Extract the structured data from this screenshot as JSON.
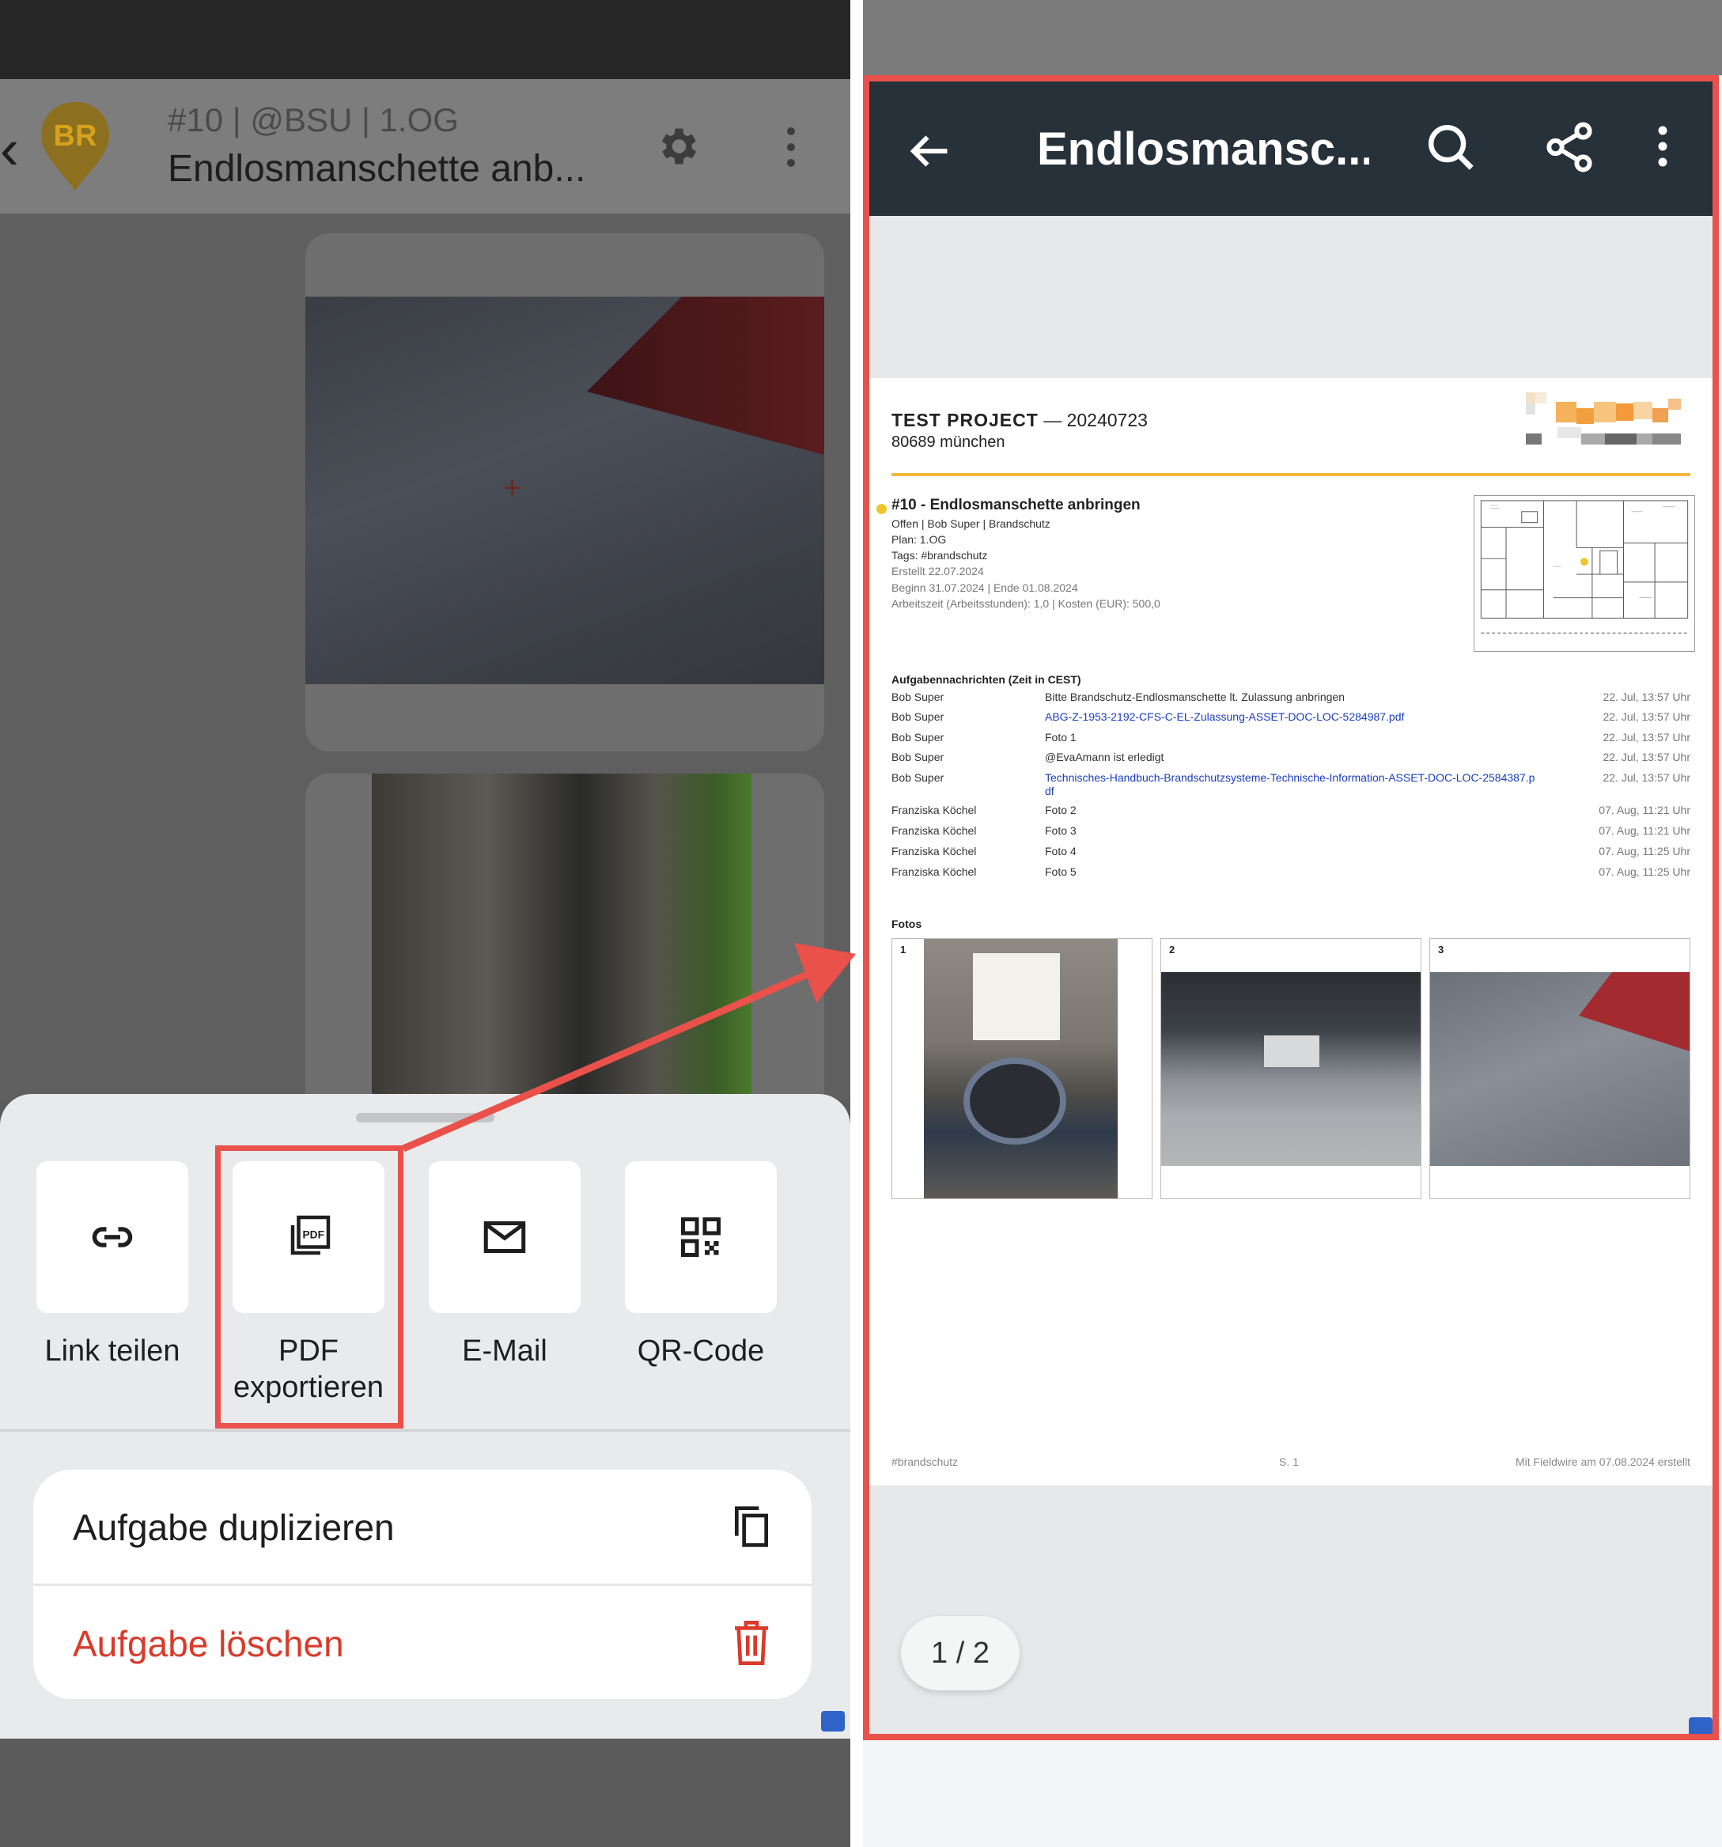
{
  "left": {
    "header": {
      "avatar_initials": "BR",
      "subtitle": "#10 | @BSU | 1.OG",
      "title": "Endlosmanschette anb..."
    },
    "share_options": [
      {
        "label": "Link teilen",
        "icon": "link-icon"
      },
      {
        "label": "PDF\nexportieren",
        "icon": "pdf-icon"
      },
      {
        "label": "E-Mail",
        "icon": "mail-icon"
      },
      {
        "label": "QR-Code",
        "icon": "qr-code-icon"
      }
    ],
    "actions": {
      "duplicate_label": "Aufgabe duplizieren",
      "delete_label": "Aufgabe löschen",
      "delete_color": "#d93a2b"
    }
  },
  "right": {
    "toolbar": {
      "title": "Endlosmansc..."
    },
    "document": {
      "project_name": "TEST PROJECT",
      "project_suffix": " — 20240723",
      "city": "80689 münchen",
      "task_title": "#10 - Endlosmanschette anbringen",
      "task_meta": [
        "Offen | Bob Super | Brandschutz",
        "Plan: 1.OG",
        "Tags: #brandschutz",
        "Erstellt 22.07.2024",
        "Beginn 31.07.2024  |  Ende 01.08.2024",
        "Arbeitszeit (Arbeitsstunden): 1,0  |  Kosten (EUR): 500,0"
      ],
      "messages_title": "Aufgabennachrichten (Zeit in CEST)",
      "messages": [
        {
          "author": "Bob Super",
          "text": "Bitte Brandschutz-Endlosmanschette lt. Zulassung anbringen",
          "time": "22. Jul, 13:57 Uhr"
        },
        {
          "author": "Bob Super",
          "text": "ABG-Z-1953-2192-CFS-C-EL-Zulassung-ASSET-DOC-LOC-5284987.pdf",
          "time": "22. Jul, 13:57 Uhr"
        },
        {
          "author": "Bob Super",
          "text": "Foto 1",
          "time": "22. Jul, 13:57 Uhr"
        },
        {
          "author": "Bob Super",
          "text": "@EvaAmann ist erledigt",
          "time": "22. Jul, 13:57 Uhr"
        },
        {
          "author": "Bob Super",
          "text": "Technisches-Handbuch-Brandschutzsysteme-Technische-Information-ASSET-DOC-LOC-2584387.pdf",
          "time": "22. Jul, 13:57 Uhr"
        },
        {
          "author": "Franziska Köchel",
          "text": "Foto 2",
          "time": "07. Aug, 11:21 Uhr"
        },
        {
          "author": "Franziska Köchel",
          "text": "Foto 3",
          "time": "07. Aug, 11:21 Uhr"
        },
        {
          "author": "Franziska Köchel",
          "text": "Foto 4",
          "time": "07. Aug, 11:25 Uhr"
        },
        {
          "author": "Franziska Köchel",
          "text": "Foto 5",
          "time": "07. Aug, 11:25 Uhr"
        }
      ],
      "photos_title": "Fotos",
      "photo_numbers": [
        "1",
        "2",
        "3"
      ],
      "footer_left": "#brandschutz",
      "footer_center": "S. 1",
      "footer_right": "Mit Fieldwire am 07.08.2024 erstellt"
    },
    "pager": "1 / 2"
  },
  "colors": {
    "highlight": "#e9514a",
    "toolbar": "#26313a",
    "accent_rule": "#f1b73a",
    "link": "#1a3dbf"
  }
}
